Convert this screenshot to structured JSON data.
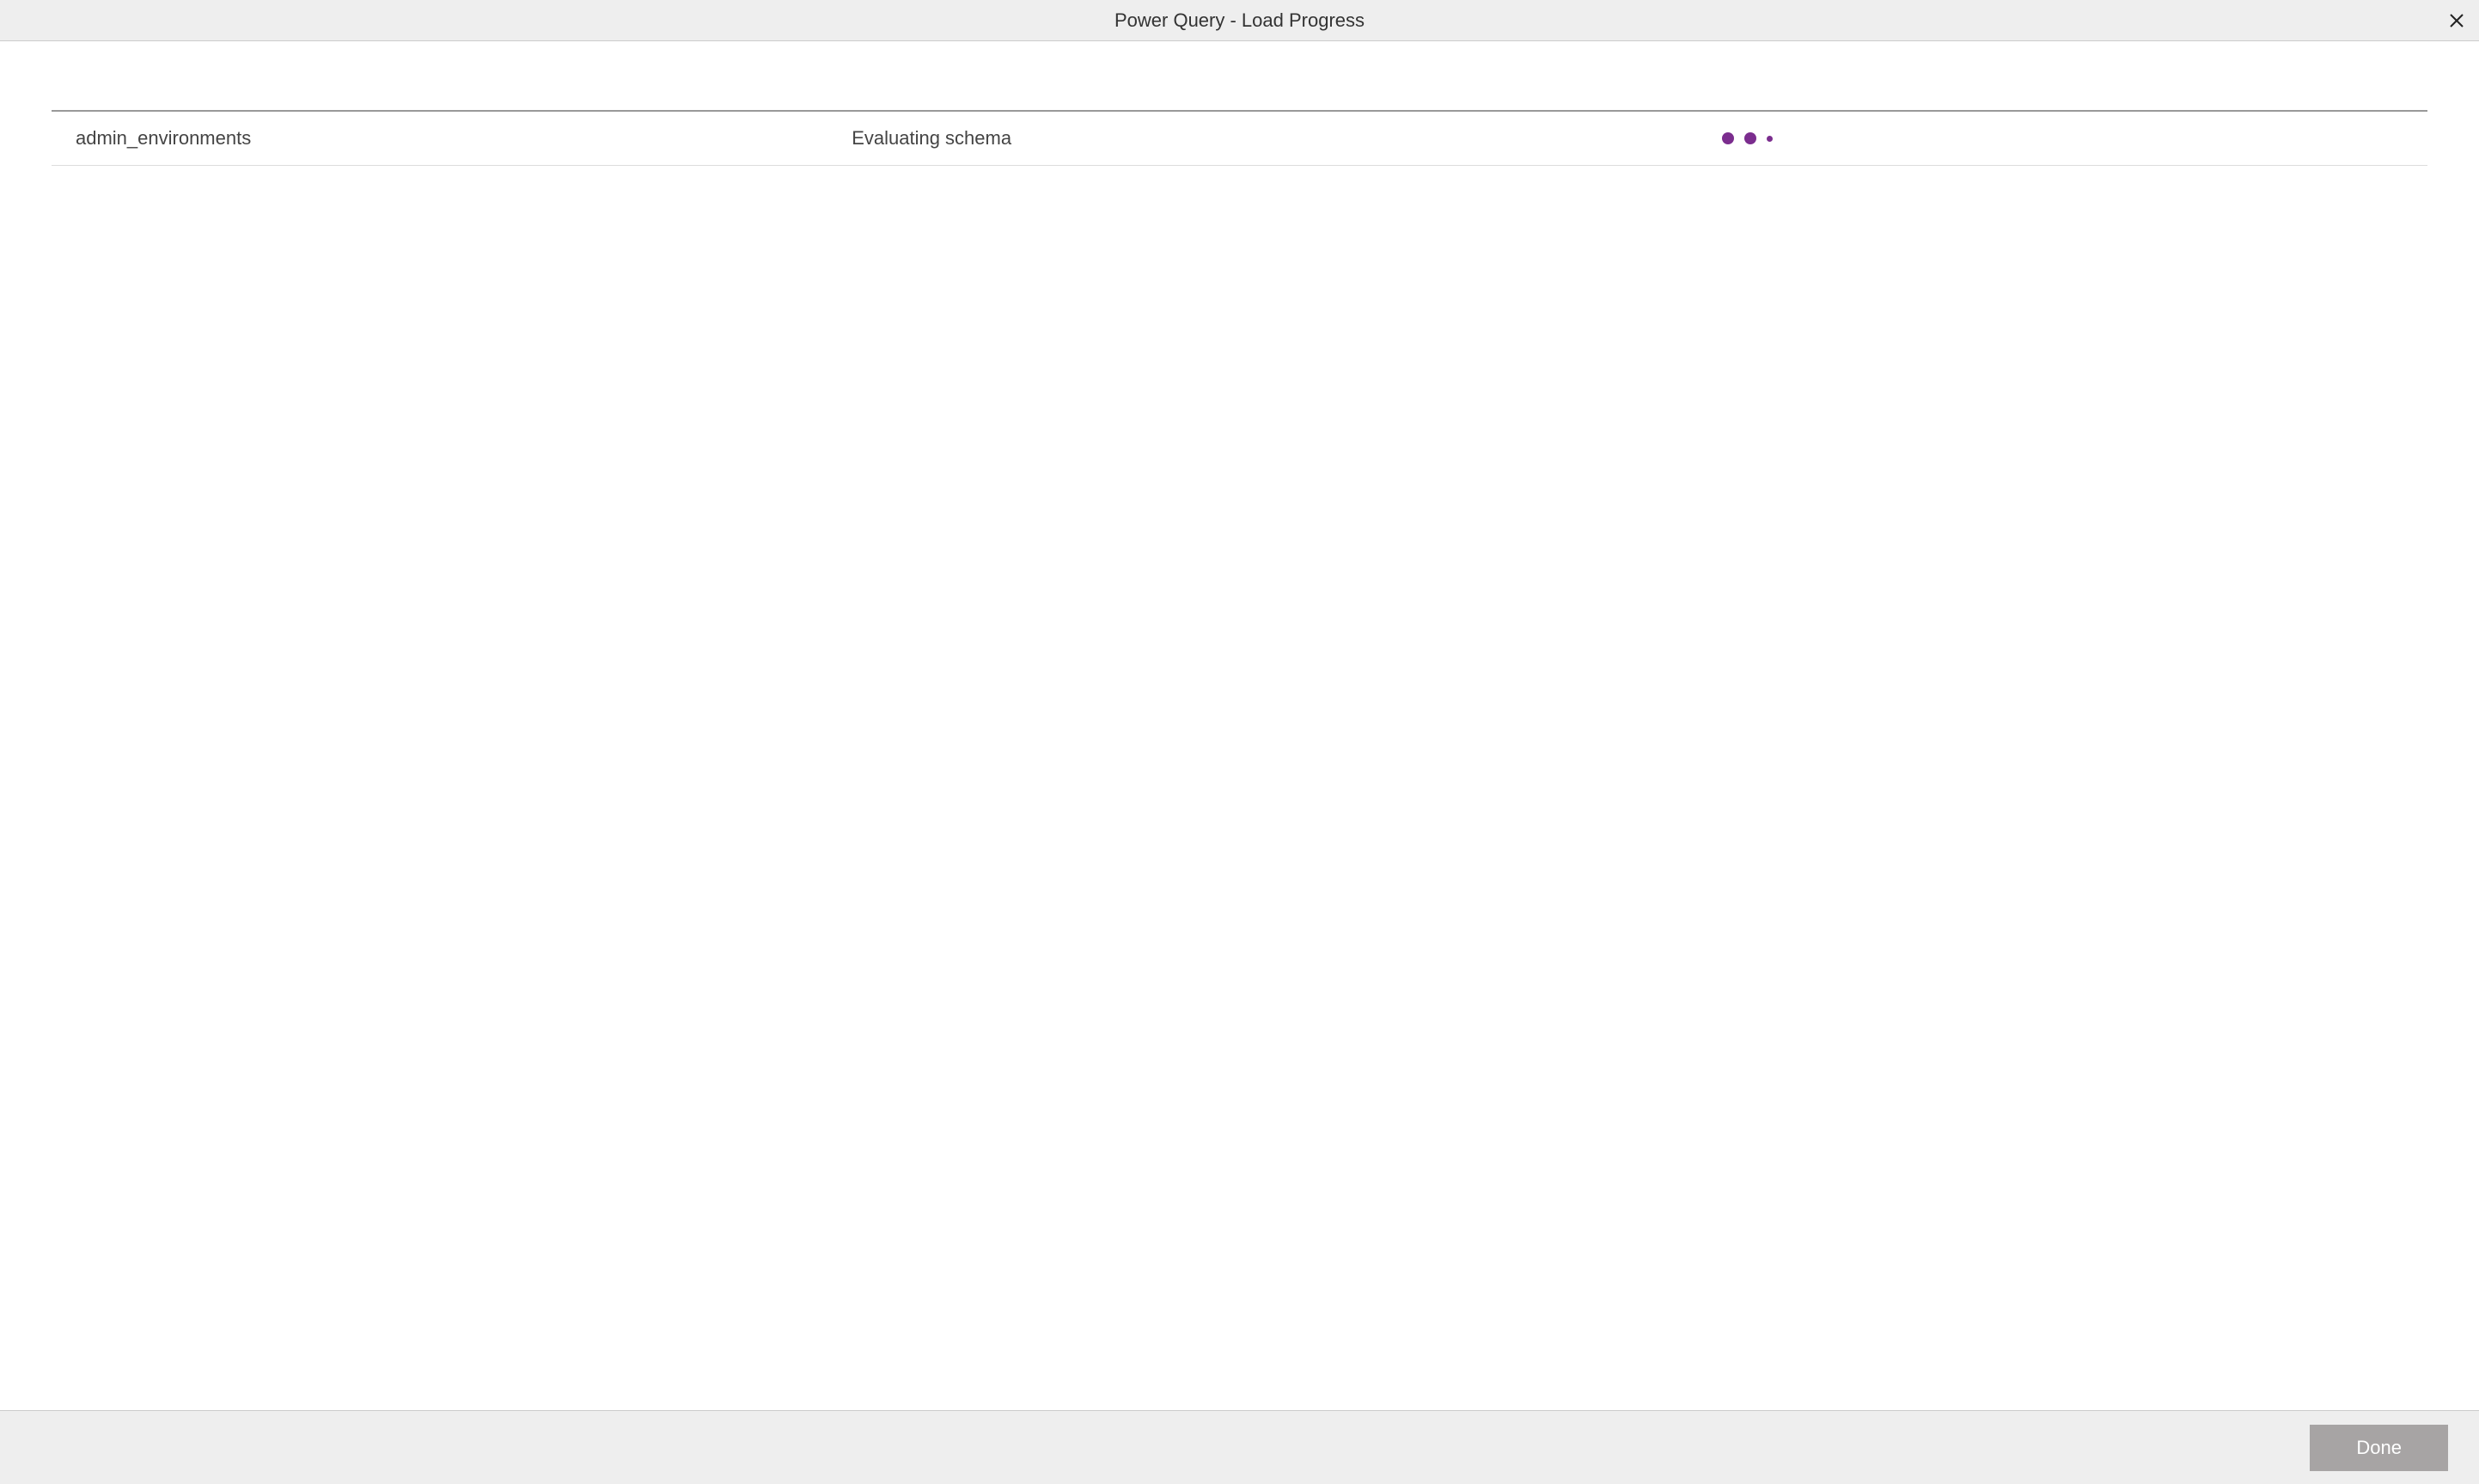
{
  "titleBar": {
    "title": "Power Query - Load Progress"
  },
  "rows": [
    {
      "name": "admin_environments",
      "status": "Evaluating schema"
    }
  ],
  "footer": {
    "doneLabel": "Done"
  },
  "colors": {
    "accent": "#7b2d8e",
    "buttonDisabled": "#a7a4a4",
    "headerBg": "#eeeeee"
  }
}
